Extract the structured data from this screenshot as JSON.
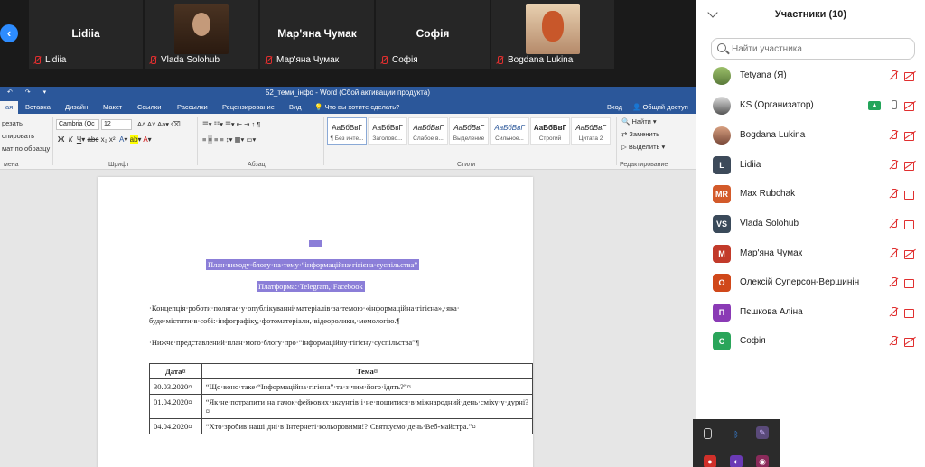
{
  "video_tiles": [
    {
      "name": "Lidiia",
      "footer": "Lidiia",
      "has_photo": false
    },
    {
      "name": "",
      "footer": "Vlada Solohub",
      "has_photo": true,
      "photo_color": "#3a2a1a"
    },
    {
      "name": "Мар'яна Чумак",
      "footer": "Мар'яна Чумак",
      "has_photo": false
    },
    {
      "name": "Софія",
      "footer": "Софія",
      "has_photo": false
    },
    {
      "name": "",
      "footer": "Bogdana Lukina",
      "has_photo": true,
      "photo_color": "#c98a5a"
    }
  ],
  "word": {
    "title": "52_теми_інфо - Word (Сбой активации продукта)",
    "tabs": [
      "Вставка",
      "Дизайн",
      "Макет",
      "Ссылки",
      "Рассылки",
      "Рецензирование",
      "Вид"
    ],
    "tell_me": "Что вы хотите сделать?",
    "sign_in": "Вход",
    "share": "Общий доступ",
    "ribbon": {
      "clipboard_items": [
        "резать",
        "опировать",
        "мат по образцу"
      ],
      "clipboard_label": "мена",
      "font_name": "Cambria (Ос",
      "font_size": "12",
      "font_label": "Шрифт",
      "paragraph_label": "Абзац",
      "styles_label": "Стили",
      "editing_label": "Редактирование",
      "editing_items": [
        "Найти",
        "Заменить",
        "Выделить"
      ],
      "styles": [
        {
          "preview": "АаБбВвГ",
          "name": "¶ Без инте..."
        },
        {
          "preview": "АаБбВвГ",
          "name": "Заголово..."
        },
        {
          "preview": "АаБбВвГ",
          "name": "Слабое в..."
        },
        {
          "preview": "АаБбВвГ",
          "name": "Выделение"
        },
        {
          "preview": "АаБбВвГ",
          "name": "Сильное..."
        },
        {
          "preview": "АаБбВвГ",
          "name": "Строгий"
        },
        {
          "preview": "АаБбВвГ",
          "name": "Цитата 2"
        }
      ]
    },
    "document": {
      "heading": "План·виходу·блогу·на·тему·“інформаційна·гігієна·суспільства”",
      "platform": "Платформа:·Telegram,·Facebook",
      "para1_line1": "·Концепція·роботи·полягає·у·опублікуванні·матеріалів·за·темою·«інформаційна·гігієна»,·яка·",
      "para1_line2": "буде·містити·в·собі:·інфографіку,·фотоматеріали,·відеоролики,·мемологію.¶",
      "para2": "·Нижче·представлений·план·мого·блогу·про·“інформаційну·гігієну·суспільства”¶",
      "table": {
        "headers": [
          "Дата¤",
          "Тема¤"
        ],
        "rows": [
          [
            "30.03.2020¤",
            "“Що·воно·таке·“Інформаційна·гігієна”·та·з·чим·його·їдять?”¤"
          ],
          [
            "01.04.2020¤",
            "“Як·не·потрапити·на·гачок·фейкових·акаунтів·і·не·пошитися·в·міжнародний·день·сміху·у·дурні?¤"
          ],
          [
            "04.04.2020¤",
            "“Хто·зробив·наші·дні·в·Інтернеті·кольоровими!?·Святкуємо·день·Веб-майстра.”¤"
          ]
        ]
      }
    }
  },
  "participants": {
    "title": "Участники (10)",
    "search_placeholder": "Найти участника",
    "list": [
      {
        "name": "Tetyana (Я)",
        "initials": "",
        "color": "#7aa05a",
        "mic": "off",
        "cam": "off",
        "photo": true
      },
      {
        "name": "KS (Организатор)",
        "initials": "",
        "color": "#555555",
        "mic": "on",
        "cam": "off-plain",
        "photo": true,
        "sharing": true
      },
      {
        "name": "Bogdana Lukina",
        "initials": "",
        "color": "#8b5a4a",
        "mic": "off",
        "cam": "off",
        "photo": true
      },
      {
        "name": "Lidiia",
        "initials": "L",
        "color": "#3d4a5a",
        "mic": "off",
        "cam": "off"
      },
      {
        "name": "Max Rubchak",
        "initials": "MR",
        "color": "#d35a2a",
        "mic": "off",
        "cam": "off-plain"
      },
      {
        "name": "Vlada Solohub",
        "initials": "VS",
        "color": "#3a4a5a",
        "mic": "off",
        "cam": "off-plain"
      },
      {
        "name": "Мар'яна Чумак",
        "initials": "М",
        "color": "#c23a2a",
        "mic": "off",
        "cam": "off"
      },
      {
        "name": "Олексій Суперсон-Вершинін",
        "initials": "О",
        "color": "#d0481a",
        "mic": "off",
        "cam": "off-plain"
      },
      {
        "name": "Пєшкова Аліна",
        "initials": "П",
        "color": "#8a3ab5",
        "mic": "off",
        "cam": "off-plain"
      },
      {
        "name": "Софія",
        "initials": "С",
        "color": "#2aa55a",
        "mic": "off",
        "cam": "off"
      }
    ]
  }
}
